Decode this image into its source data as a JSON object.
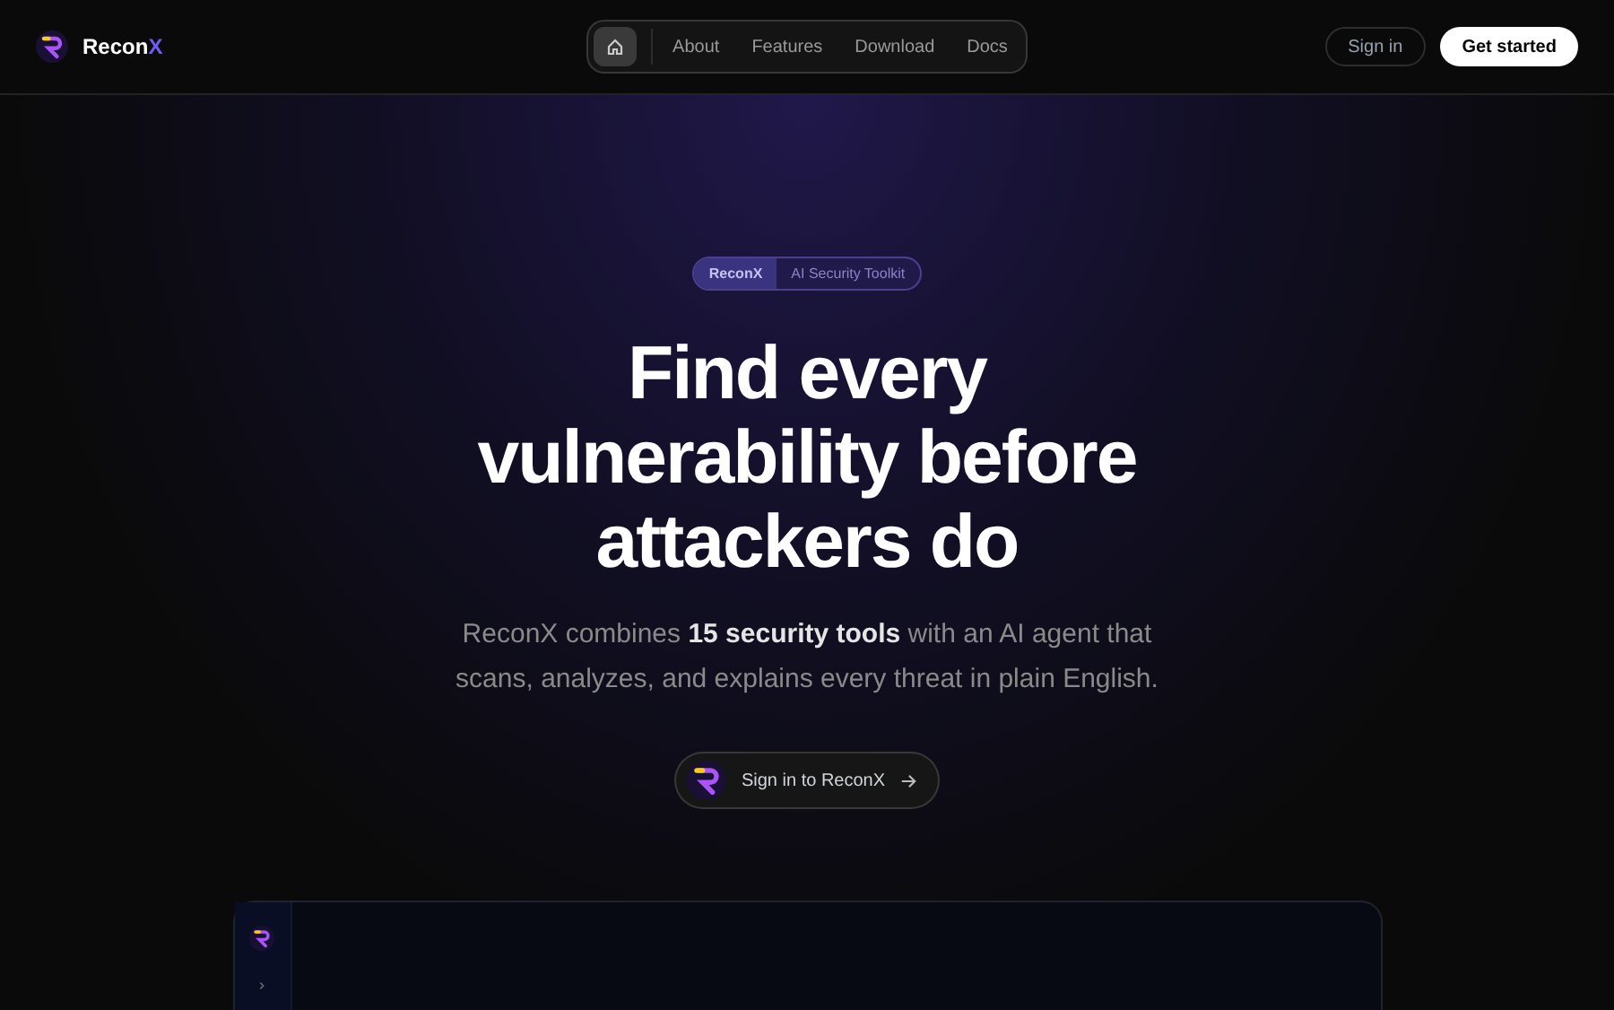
{
  "brand": {
    "name": "Recon",
    "accent": "X"
  },
  "nav": [
    {
      "kind": "home",
      "selected": true
    },
    {
      "kind": "link",
      "label": "About",
      "selected": false
    },
    {
      "kind": "link",
      "label": "Features",
      "selected": false
    },
    {
      "kind": "link",
      "label": "Download",
      "selected": false
    },
    {
      "kind": "link",
      "label": "Docs",
      "selected": false
    }
  ],
  "actions": {
    "sign_in": "Sign in",
    "get_started": "Get started"
  },
  "hero": {
    "badge": {
      "tag": "ReconX",
      "text": "AI Security Toolkit"
    },
    "title": "Find every vulnerability before attackers do",
    "subtitle": "ReconX combines **15 security tools** with an AI agent that scans, analyzes, and explains every threat in plain English.",
    "cta": "Sign in to ReconX"
  }
}
